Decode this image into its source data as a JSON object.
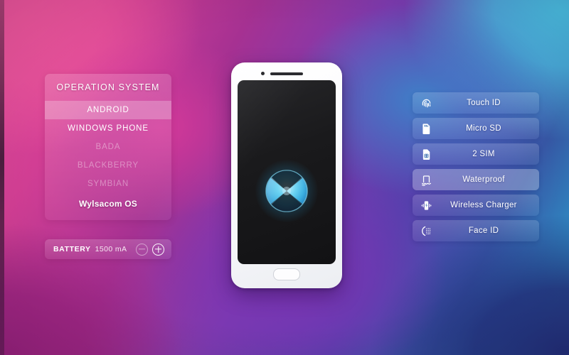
{
  "background": {
    "colors": {
      "top_left": "#E84F9E",
      "top_right": "#45BDE3",
      "bottom_left": "#9A2280",
      "bottom_right": "#232E7C",
      "center": "#7B34B4"
    }
  },
  "os_panel": {
    "title": "OPERATION SYSTEM",
    "items": [
      {
        "label": "ANDROID",
        "state": "selected"
      },
      {
        "label": "WINDOWS PHONE",
        "state": "normal"
      },
      {
        "label": "BADA",
        "state": "dim"
      },
      {
        "label": "BLACKBERRY",
        "state": "dim"
      },
      {
        "label": "SYMBIAN",
        "state": "dim"
      },
      {
        "label": "Wylsacom OS",
        "state": "brand"
      }
    ]
  },
  "battery": {
    "label": "BATTERY",
    "value": "1500 mA",
    "decrease_label": "−",
    "increase_label": "+"
  },
  "phone": {
    "camera_icon": "camera-dot",
    "speaker_icon": "earpiece-speaker",
    "home_icon": "home-button",
    "logo_icon": "wylsacom-logo"
  },
  "features": {
    "items": [
      {
        "label": "Touch ID",
        "icon": "fingerprint-icon",
        "state": "normal"
      },
      {
        "label": "Micro SD",
        "icon": "sd-card-icon",
        "state": "normal"
      },
      {
        "label": "2 SIM",
        "icon": "sim-card-icon",
        "state": "normal"
      },
      {
        "label": "Waterproof",
        "icon": "waterproof-icon",
        "state": "selected"
      },
      {
        "label": "Wireless Charger",
        "icon": "wireless-charging-icon",
        "state": "normal"
      },
      {
        "label": "Face ID",
        "icon": "face-id-icon",
        "state": "normal"
      }
    ]
  }
}
